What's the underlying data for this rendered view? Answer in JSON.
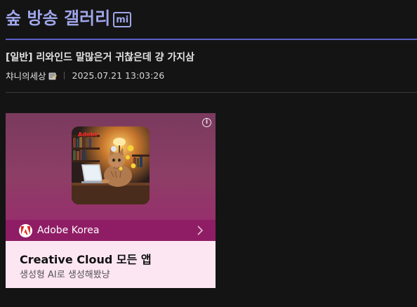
{
  "gallery": {
    "title": "숲 방송 갤러리",
    "badge": "mi"
  },
  "post": {
    "title": "[일반] 리와인드 말많은거 귀찮은데 걍 가지삼",
    "author": "챠니의세상",
    "author_icon": "fixed-nick-icon",
    "date": "2025.07.21 13:03:26"
  },
  "ad": {
    "info_icon": "info-icon",
    "image_logo": "Adobe",
    "brand_name": "Adobe Korea",
    "headline": "Creative Cloud 모든 앱",
    "subtext": "생성형 AI로 생성해봤냥",
    "colors": {
      "hero": "#8e3e66",
      "brand_bar": "#8f1d65",
      "body": "#fce6f1"
    }
  },
  "colors": {
    "accent": "#9fa6ea",
    "divider": "#5a5fc8",
    "background": "#141414"
  }
}
